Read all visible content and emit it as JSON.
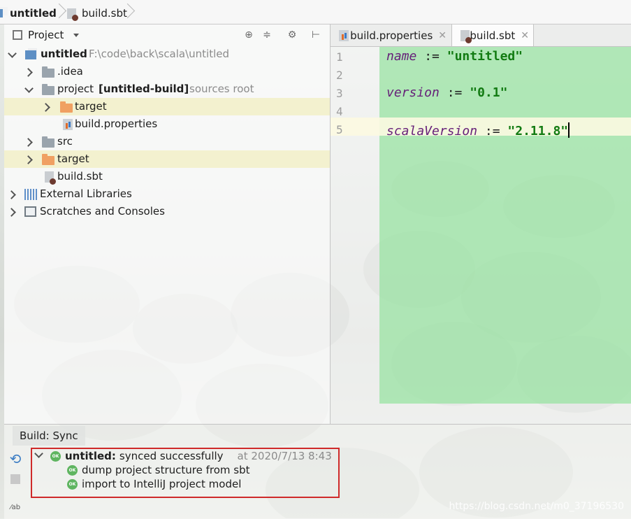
{
  "breadcrumbs": [
    {
      "label": "untitled",
      "icon": "module-icon"
    },
    {
      "label": "build.sbt",
      "icon": "sbt-file-icon"
    }
  ],
  "project_panel": {
    "title": "Project",
    "tools": [
      "locate-icon",
      "collapse-all-icon",
      "gear-icon",
      "hide-icon"
    ],
    "tree": [
      {
        "name": "untitled",
        "path": "F:\\code\\back\\scala\\untitled",
        "expanded": true,
        "icon": "module-icon"
      },
      {
        "name": ".idea",
        "icon": "folder-icon"
      },
      {
        "name": "project",
        "module": "[untitled-build]",
        "note": "sources root",
        "expanded": true,
        "icon": "sbt-folder-icon"
      },
      {
        "name": "target",
        "icon": "folder-orange-icon"
      },
      {
        "name": "build.properties",
        "icon": "properties-file-icon"
      },
      {
        "name": "src",
        "icon": "folder-icon"
      },
      {
        "name": "target",
        "icon": "folder-orange-icon"
      },
      {
        "name": "build.sbt",
        "icon": "sbt-file-icon"
      },
      {
        "name": "External Libraries",
        "icon": "libraries-icon"
      },
      {
        "name": "Scratches and Consoles",
        "icon": "scratch-icon"
      }
    ]
  },
  "editor": {
    "tabs": [
      {
        "label": "build.properties",
        "active": false
      },
      {
        "label": "build.sbt",
        "active": true
      }
    ],
    "line_numbers": [
      "1",
      "2",
      "3",
      "4",
      "5"
    ],
    "code": [
      {
        "key": "name",
        "op": ":=",
        "value": "\"untitled\""
      },
      {
        "key": "version",
        "op": ":=",
        "value": "\"0.1\""
      },
      {
        "key": "scalaVersion",
        "op": ":=",
        "value": "\"2.11.8\""
      }
    ]
  },
  "build": {
    "tab_label": "Build: Sync",
    "root": {
      "title": "untitled:",
      "status": "synced successfully",
      "time": "at 2020/7/13 8:43",
      "badge": "OK"
    },
    "children": [
      {
        "label": "dump project structure from sbt",
        "badge": "OK"
      },
      {
        "label": "import to IntelliJ project model",
        "badge": "OK"
      }
    ],
    "highlight_color": "#cf2a2a"
  },
  "watermark": "https://blog.csdn.net/m0_37196530",
  "colors": {
    "code_bg": "#96e2a0",
    "keyword": "#651f78",
    "string": "#127b12",
    "highlight_row": "#f2f0c8",
    "ok_badge": "#5fb560"
  }
}
